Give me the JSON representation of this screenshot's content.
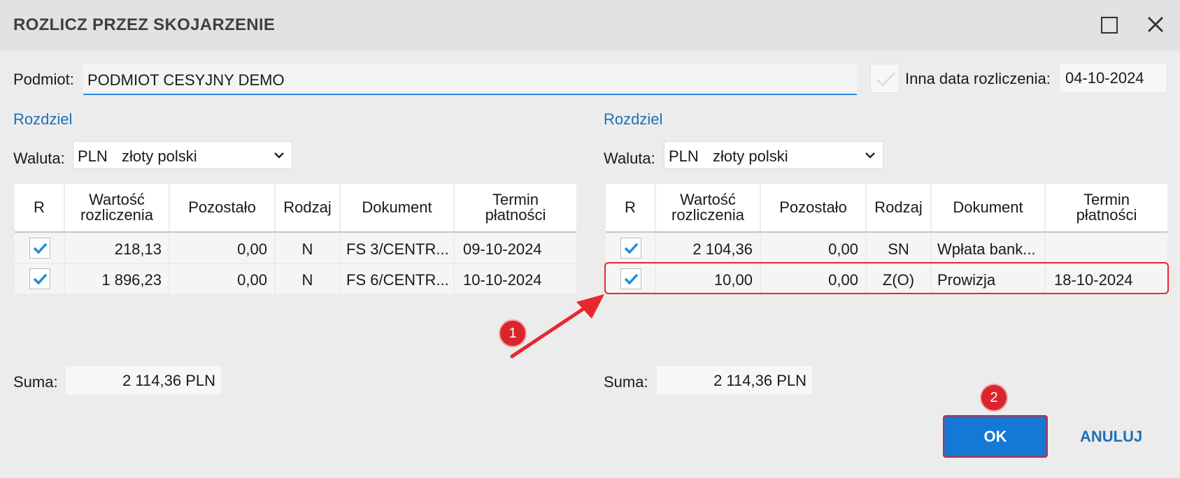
{
  "dialog": {
    "title": "ROZLICZ PRZEZ SKOJARZENIE"
  },
  "top": {
    "podmiot_label": "Podmiot:",
    "podmiot_value": "PODMIOT CESYJNY DEMO",
    "inna_data_label": "Inna data rozliczenia:",
    "inna_data_value": "04-10-2024"
  },
  "columns": [
    "R",
    "Wartość rozliczenia",
    "Pozostało",
    "Rodzaj",
    "Dokument",
    "Termin płatności"
  ],
  "left": {
    "rozdziel": "Rozdziel",
    "waluta_label": "Waluta:",
    "waluta_code": "PLN",
    "waluta_name": "złoty polski",
    "rows": [
      {
        "checked": true,
        "wartosc": "218,13",
        "pozostalo": "0,00",
        "rodzaj": "N",
        "dokument": "FS 3/CENTR...",
        "termin": "09-10-2024"
      },
      {
        "checked": true,
        "wartosc": "1 896,23",
        "pozostalo": "0,00",
        "rodzaj": "N",
        "dokument": "FS 6/CENTR...",
        "termin": "10-10-2024"
      }
    ],
    "suma_label": "Suma:",
    "suma_value": "2 114,36 PLN"
  },
  "right": {
    "rozdziel": "Rozdziel",
    "waluta_label": "Waluta:",
    "waluta_code": "PLN",
    "waluta_name": "złoty polski",
    "rows": [
      {
        "checked": true,
        "wartosc": "2 104,36",
        "pozostalo": "0,00",
        "rodzaj": "SN",
        "dokument": "Wpłata bank...",
        "termin": ""
      },
      {
        "checked": true,
        "wartosc": "10,00",
        "pozostalo": "0,00",
        "rodzaj": "Z(O)",
        "dokument": "Prowizja",
        "termin": "18-10-2024"
      }
    ],
    "suma_label": "Suma:",
    "suma_value": "2 114,36 PLN"
  },
  "annotations": {
    "badge_1": "1",
    "badge_2": "2",
    "highlight_color": "#e5282e"
  },
  "buttons": {
    "ok": "OK",
    "cancel": "ANULUJ"
  },
  "colors": {
    "accent": "#1478d4",
    "link": "#1f6fb5",
    "annotation_red": "#d9262c"
  }
}
